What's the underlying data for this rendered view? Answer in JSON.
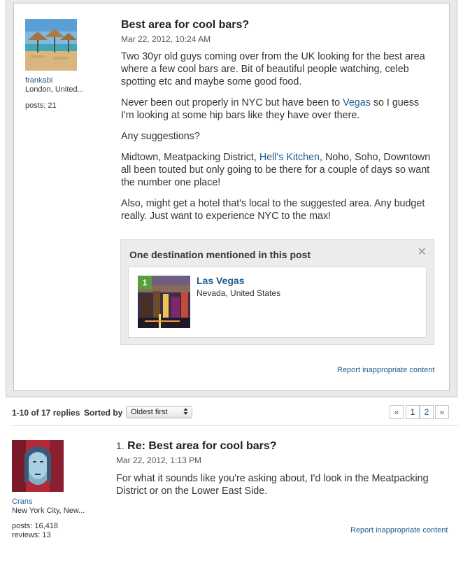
{
  "original_post": {
    "username": "frankabi",
    "location": "London, United...",
    "posts": "posts: 21",
    "title": "Best area for cool bars?",
    "date": "Mar 22, 2012, 10:24 AM",
    "body": {
      "p1": "Two 30yr old guys coming over from the UK looking for the best area where a few cool bars are. Bit of beautiful people watching, celeb spotting etc and maybe some good food.",
      "p2_before": "Never been out properly in NYC but have been to ",
      "p2_link": "Vegas",
      "p2_after": " so I guess I'm looking at some hip bars like they have over there.",
      "p3": "Any suggestions?",
      "p4_before": "Midtown, Meatpacking District, ",
      "p4_link": "Hell's Kitchen",
      "p4_after": ", Noho, Soho, Downtown all been touted but only going to be there for a couple of days so want the number one place!",
      "p5": "Also, might get a hotel that's local to the suggested area. Any budget really. Just want to experience NYC to the max!"
    },
    "destination_box": {
      "heading": "One destination mentioned in this post",
      "close": "✕",
      "item": {
        "number": "1",
        "name": "Las Vegas",
        "location": "Nevada, United States"
      }
    },
    "report": "Report inappropriate content"
  },
  "replies_bar": {
    "count": "1-10 of 17 replies",
    "sorted_label": "Sorted by",
    "sort_value": "Oldest first",
    "sort_arrow": "▲▼",
    "prev": "«",
    "pages": [
      "1",
      "2"
    ],
    "next": "»"
  },
  "reply": {
    "number": "1.",
    "title": "Re: Best area for cool bars?",
    "date": "Mar 22, 2012, 1:13 PM",
    "body": "For what it sounds like you're asking about, I'd look in the Meatpacking District or on the Lower East Side.",
    "username": "Crans",
    "location": "New York City, New...",
    "posts": "posts: 16,418",
    "reviews": "reviews: 13",
    "report": "Report inappropriate content"
  }
}
